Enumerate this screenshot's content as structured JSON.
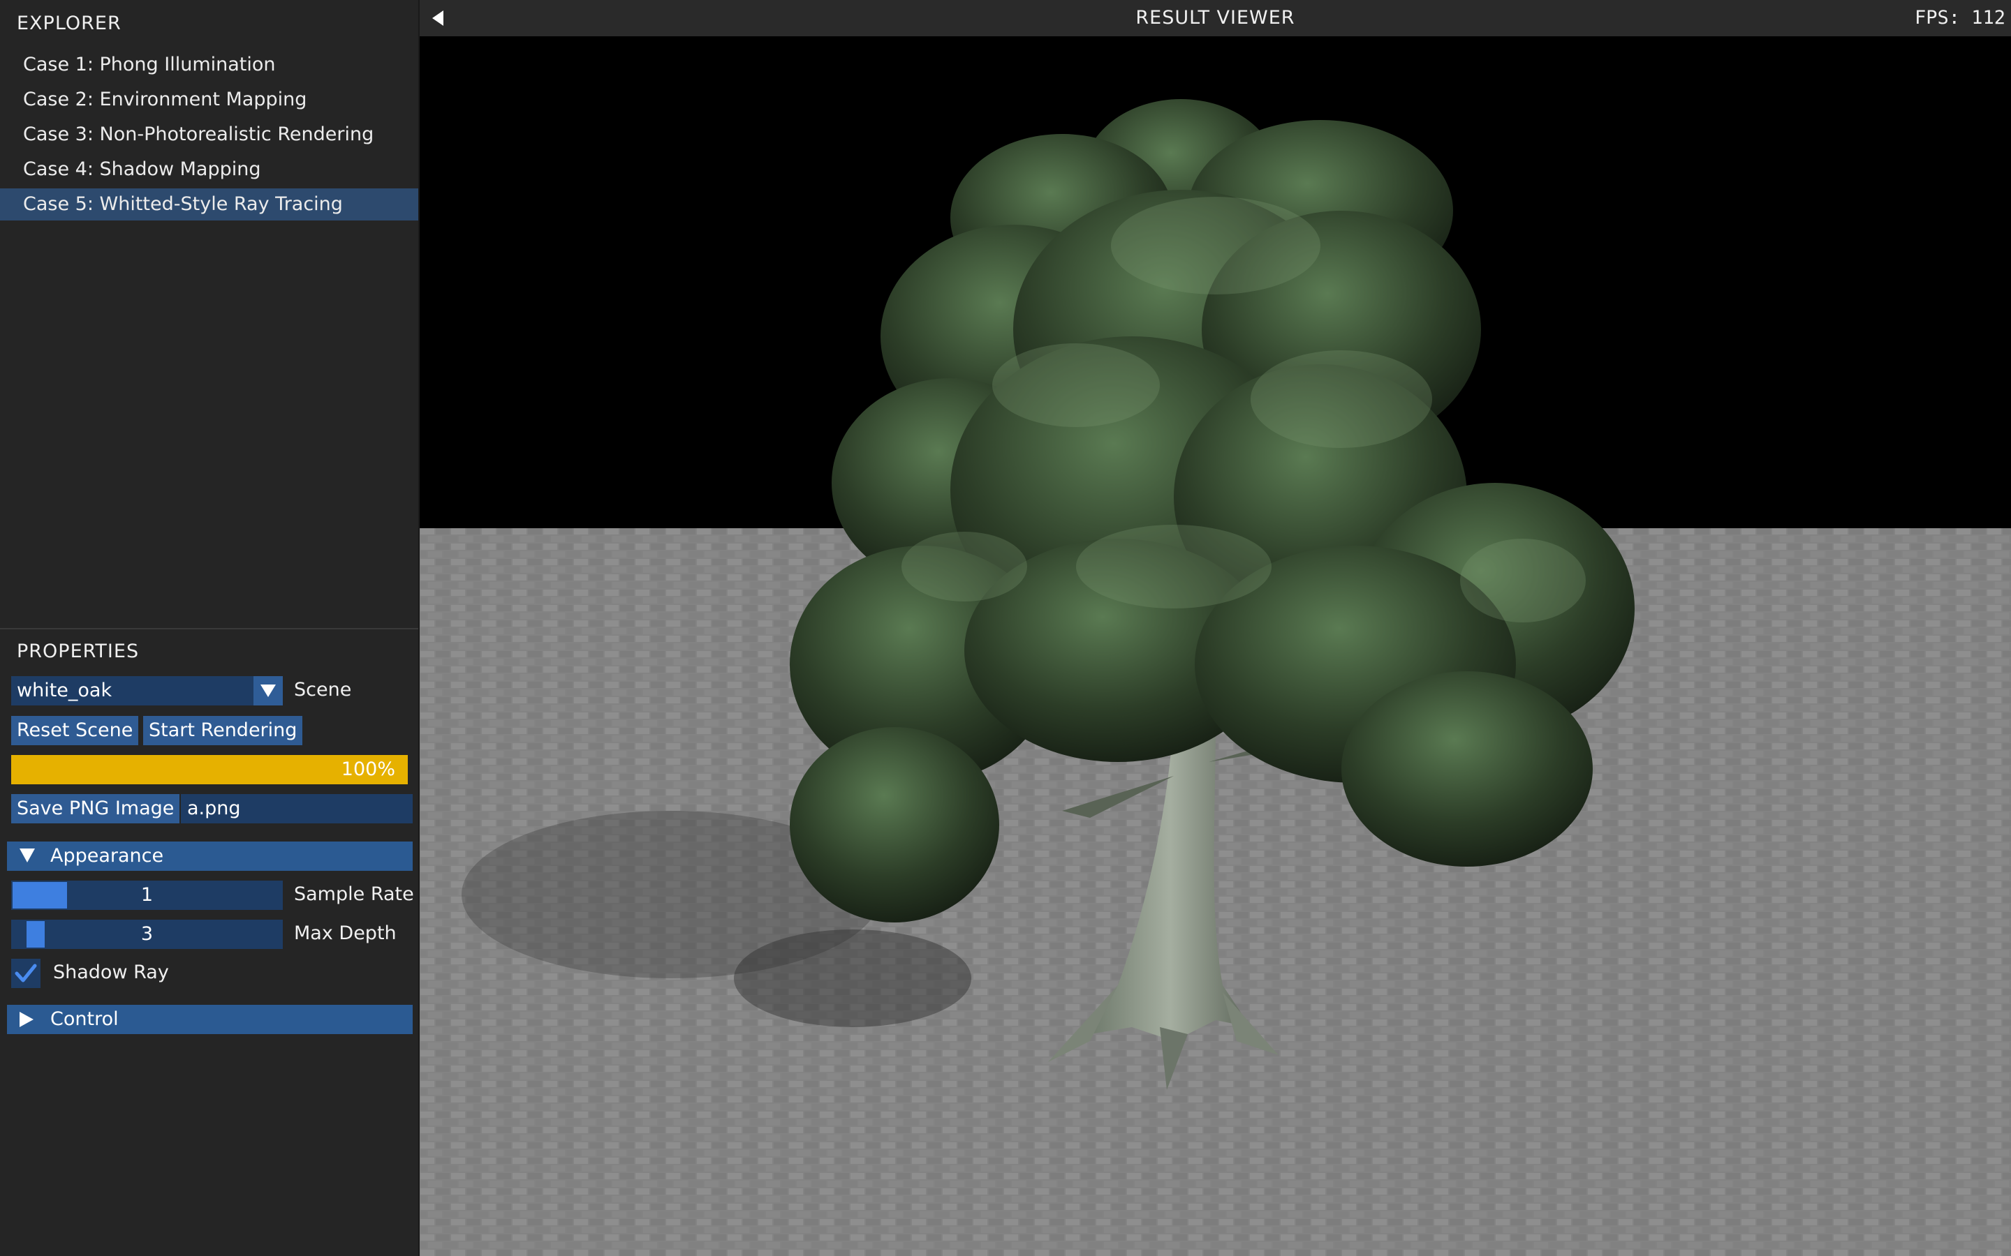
{
  "explorer": {
    "title": "EXPLORER",
    "cases": [
      {
        "label": "Case 1: Phong Illumination",
        "selected": false
      },
      {
        "label": "Case 2: Environment Mapping",
        "selected": false
      },
      {
        "label": "Case 3: Non-Photorealistic Rendering",
        "selected": false
      },
      {
        "label": "Case 4: Shadow Mapping",
        "selected": false
      },
      {
        "label": "Case 5: Whitted-Style Ray Tracing",
        "selected": true
      }
    ]
  },
  "properties": {
    "title": "PROPERTIES",
    "scene": {
      "value": "white_oak",
      "label": "Scene"
    },
    "reset_label": "Reset Scene",
    "start_label": "Start Rendering",
    "progress": {
      "value": 1.0,
      "text": "100%"
    },
    "save_label": "Save PNG Image",
    "filename": "a.png",
    "appearance": {
      "label": "Appearance",
      "expanded": true,
      "sample_rate": {
        "value": "1",
        "label": "Sample Rate",
        "fraction": 0.0
      },
      "max_depth": {
        "value": "3",
        "label": "Max Depth",
        "fraction": 0.2
      },
      "shadow_ray": {
        "label": "Shadow Ray",
        "checked": true
      }
    },
    "control": {
      "label": "Control",
      "expanded": false
    }
  },
  "viewer": {
    "title": "RESULT VIEWER",
    "fps": "FPS:  112"
  },
  "colors": {
    "panel_bg": "#252525",
    "selected_row": "#2d4a6e",
    "frame_bg": "#1e3c64",
    "button": "#2f5b93",
    "accent": "#3e7fe0",
    "progress": "#e6b100",
    "floor": "#8a8a8a",
    "foliage": "#2f4028"
  },
  "icons": [
    "chevron-down-icon",
    "triangle-down-icon",
    "triangle-right-icon",
    "checkmark-icon",
    "collapse-left-icon"
  ]
}
